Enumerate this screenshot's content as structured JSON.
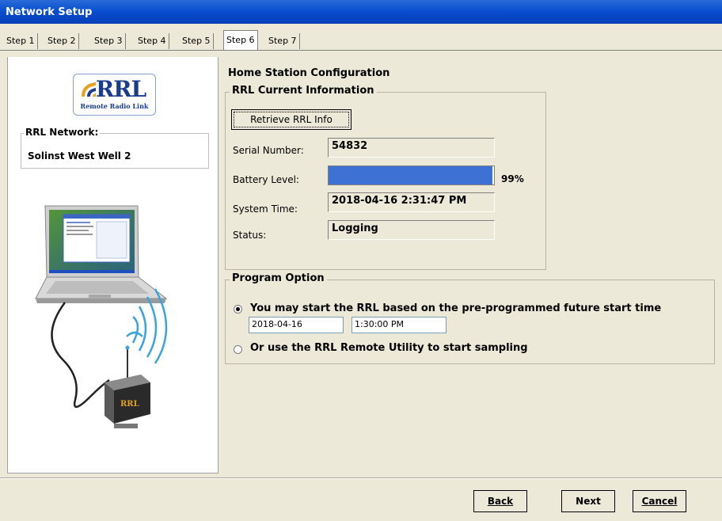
{
  "window": {
    "title": "Network Setup"
  },
  "tabs": [
    {
      "label": "Step 1"
    },
    {
      "label": "Step 2"
    },
    {
      "label": "Step 3"
    },
    {
      "label": "Step 4"
    },
    {
      "label": "Step 5"
    },
    {
      "label": "Step 6"
    },
    {
      "label": "Step 7"
    }
  ],
  "active_tab": "Step 6",
  "sidebar": {
    "logo_text": "RRL",
    "logo_subtext": "Remote Radio Link",
    "network_label": "RRL Network:",
    "network_name": "Solinst West Well 2",
    "device_logo_text": "RRL"
  },
  "main": {
    "title": "Home Station Configuration",
    "current_info": {
      "group_label": "RRL Current Information",
      "retrieve_button": "Retrieve RRL Info",
      "serial_label": "Serial Number:",
      "serial_value": "54832",
      "battery_label": "Battery Level:",
      "battery_percent": 99,
      "battery_text": "99%",
      "system_time_label": "System Time:",
      "system_time_value": "2018-04-16 2:31:47 PM",
      "status_label": "Status:",
      "status_value": "Logging"
    },
    "program_option": {
      "group_label": "Program Option",
      "option1_label": "You may start the RRL based on the pre-programmed future start time",
      "option1_selected": true,
      "start_date": "2018-04-16",
      "start_time": "1:30:00 PM",
      "option2_label": "Or use the RRL Remote Utility to start sampling",
      "option2_selected": false
    }
  },
  "footer": {
    "back": "Back",
    "next": "Next",
    "cancel": "Cancel"
  },
  "colors": {
    "titlebar": "#0a50d0",
    "battery_fill": "#3d72d4",
    "dialog_bg": "#ece9d8"
  }
}
